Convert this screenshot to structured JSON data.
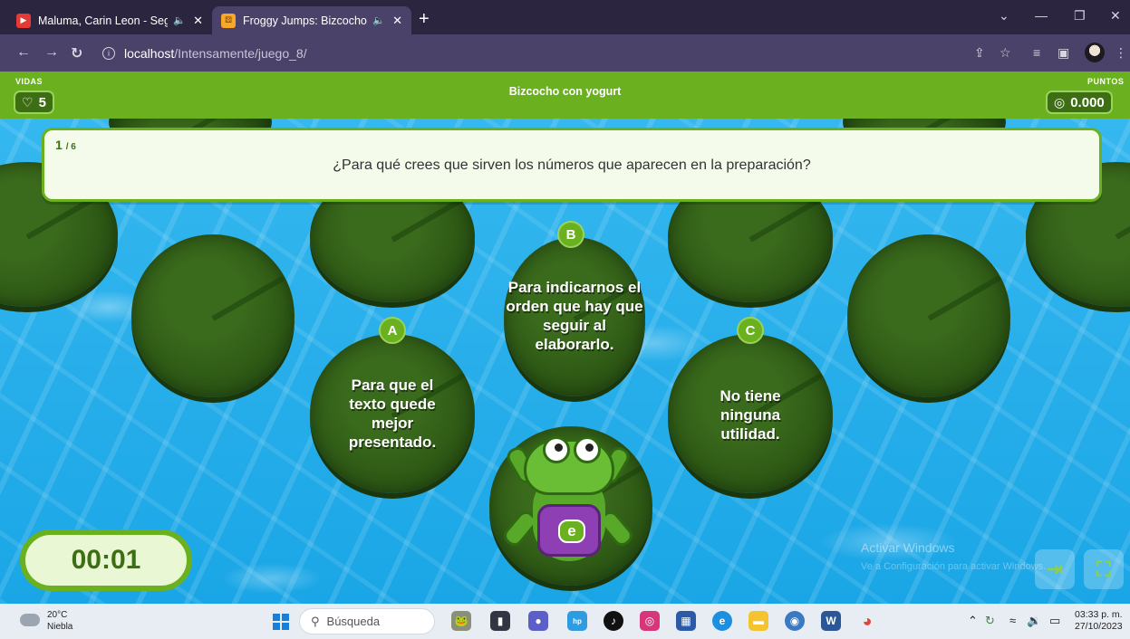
{
  "browser": {
    "tabs": [
      {
        "title": "Maluma, Carin Leon - Según",
        "active": false
      },
      {
        "title": "Froggy Jumps: Bizcocho con",
        "active": true
      }
    ],
    "new_tab": "+",
    "url_host": "localhost",
    "url_path": "/Intensamente/juego_8/",
    "window_controls": {
      "dropdown": "⌄",
      "minimize": "—",
      "restore": "❐",
      "close": "✕"
    }
  },
  "game": {
    "lives_label": "VIDAS",
    "lives": "5",
    "title": "Bizcocho con yogurt",
    "points_label": "PUNTOS",
    "points": "0.000",
    "question": {
      "current": "1",
      "total": "/ 6",
      "text": "¿Para qué crees que sirven los números que aparecen en la preparación?"
    },
    "answers": [
      {
        "letter": "A",
        "text": "Para que el texto quede mejor presentado."
      },
      {
        "letter": "B",
        "text": "Para indicarnos el orden que hay que seguir al elaborarlo."
      },
      {
        "letter": "C",
        "text": "No tiene ninguna utilidad."
      }
    ],
    "frog_badge": "e",
    "timer": "00:01",
    "watermark": "Activar Windows",
    "watermark_sub": "Ve a Configuración para activar Windows."
  },
  "taskbar": {
    "temperature": "20°C",
    "weather": "Niebla",
    "search_placeholder": "Búsqueda",
    "time": "03:33 p. m.",
    "date": "27/10/2023"
  },
  "colors": {
    "header_green": "#6ab01f",
    "pill_green": "#3e6e13",
    "water": "#1aa6e6",
    "tab_bar": "#2b2540",
    "address_bar": "#4a4268"
  }
}
